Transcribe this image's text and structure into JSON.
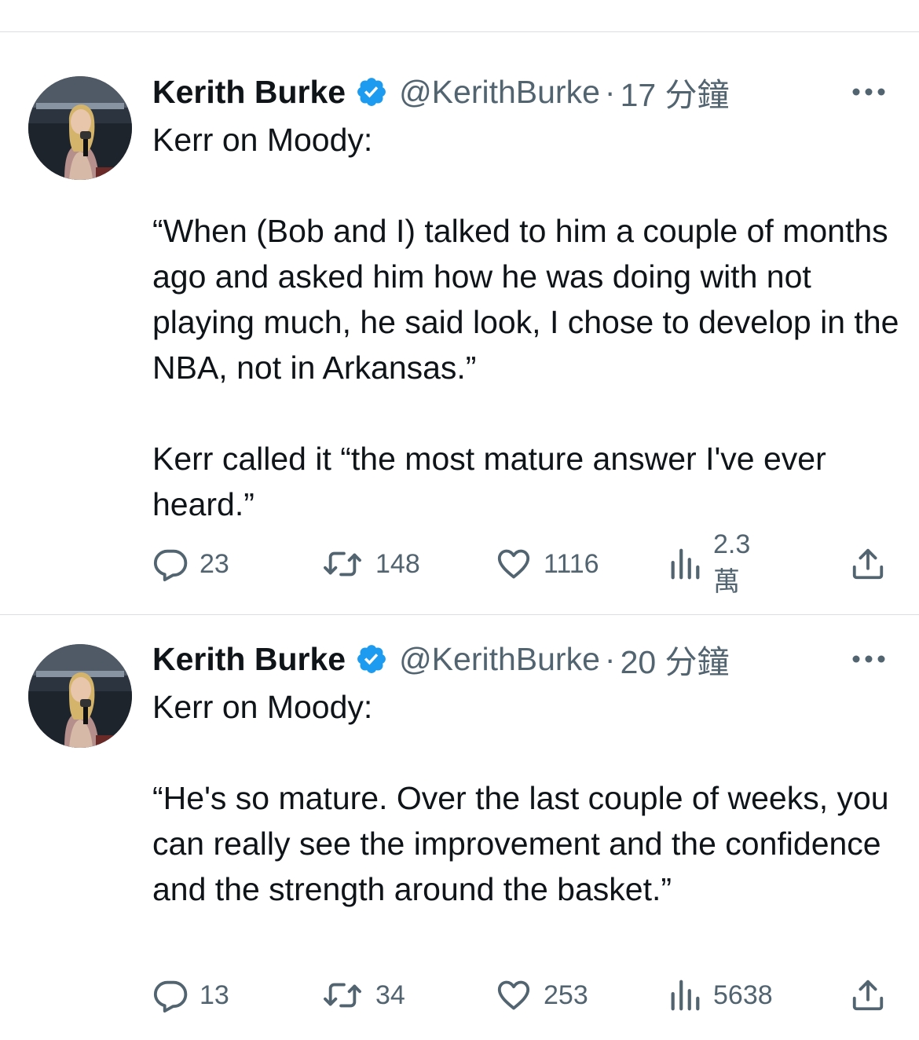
{
  "tweets": [
    {
      "author": {
        "name": "Kerith Burke",
        "handle": "@KerithBurke",
        "verified": true
      },
      "time": "17 分鐘",
      "separator": "·",
      "text": "Kerr on Moody:\n\n“When (Bob and I) talked to him a couple of months ago and asked him how he was doing with not playing much, he said look, I chose to develop in the NBA, not in Arkansas.”\n\nKerr called it “the most mature answer I've ever heard.”",
      "stats": {
        "replies": "23",
        "retweets": "148",
        "likes": "1116",
        "views": "2.3萬"
      }
    },
    {
      "author": {
        "name": "Kerith Burke",
        "handle": "@KerithBurke",
        "verified": true
      },
      "time": "20 分鐘",
      "separator": "·",
      "text": "Kerr on Moody:\n\n“He's so mature. Over the last couple of weeks, you can really see the improvement and the confidence and the strength around the basket.”",
      "stats": {
        "replies": "13",
        "retweets": "34",
        "likes": "253",
        "views": "5638"
      }
    }
  ],
  "icons": {
    "reply": "reply-icon",
    "retweet": "retweet-icon",
    "like": "heart-icon",
    "views": "views-icon",
    "share": "share-icon",
    "more": "more-icon",
    "verified": "verified-badge-icon"
  },
  "colors": {
    "text": "#0f1419",
    "secondary": "#536471",
    "verified": "#1d9bf0",
    "divider": "#dcdfe2"
  }
}
